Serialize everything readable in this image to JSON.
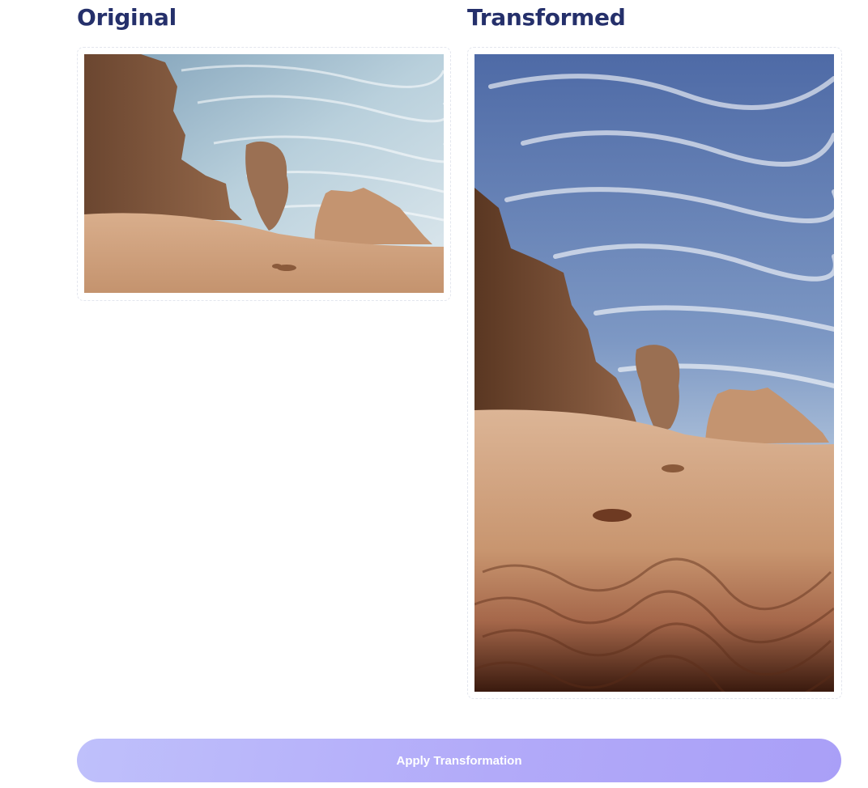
{
  "panels": {
    "original": {
      "title": "Original",
      "image_subject": "desert-rock-formations-landscape"
    },
    "transformed": {
      "title": "Transformed",
      "image_subject": "desert-rock-formations-landscape-portrait"
    }
  },
  "actions": {
    "apply_label": "Apply Transformation",
    "apply_state": "disabled"
  },
  "colors": {
    "heading": "#25306b",
    "button_gradient_start": "#bfc0fb",
    "button_gradient_end": "#a99ff7",
    "button_text": "#ffffff",
    "frame_border": "#e3e6ee"
  }
}
